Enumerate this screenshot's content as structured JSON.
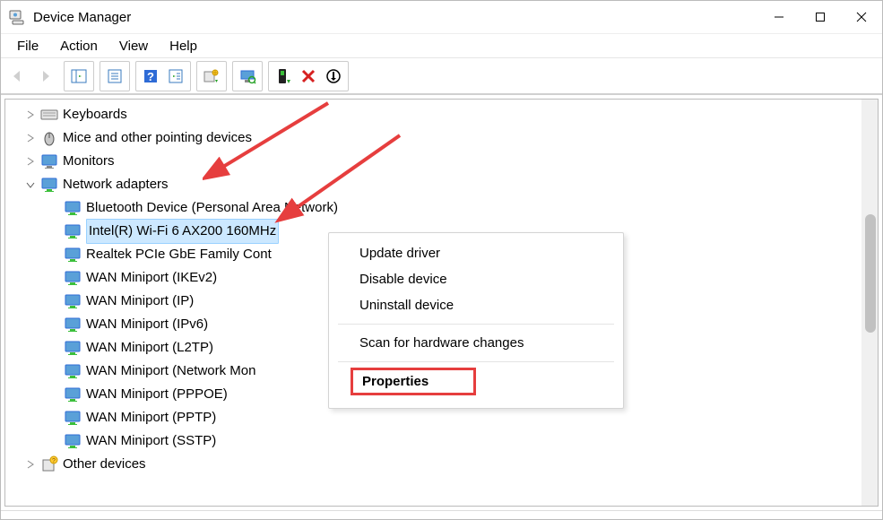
{
  "window": {
    "title": "Device Manager"
  },
  "menubar": {
    "items": [
      {
        "label": "File"
      },
      {
        "label": "Action"
      },
      {
        "label": "View"
      },
      {
        "label": "Help"
      }
    ]
  },
  "tree": {
    "keyboards": "Keyboards",
    "mice": "Mice and other pointing devices",
    "monitors": "Monitors",
    "network_adapters": "Network adapters",
    "children": {
      "bt": "Bluetooth Device (Personal Area Network)",
      "wifi": "Intel(R) Wi-Fi 6 AX200 160MHz",
      "realtek": "Realtek PCIe GbE Family Cont",
      "wan_ikev2": "WAN Miniport (IKEv2)",
      "wan_ip": "WAN Miniport (IP)",
      "wan_ipv6": "WAN Miniport (IPv6)",
      "wan_l2tp": "WAN Miniport (L2TP)",
      "wan_netmon": "WAN Miniport (Network Mon",
      "wan_pppoe": "WAN Miniport (PPPOE)",
      "wan_pptp": "WAN Miniport (PPTP)",
      "wan_sstp": "WAN Miniport (SSTP)"
    },
    "other_devices": "Other devices"
  },
  "context_menu": {
    "update": "Update driver",
    "disable": "Disable device",
    "uninstall": "Uninstall device",
    "scan": "Scan for hardware changes",
    "properties": "Properties"
  }
}
